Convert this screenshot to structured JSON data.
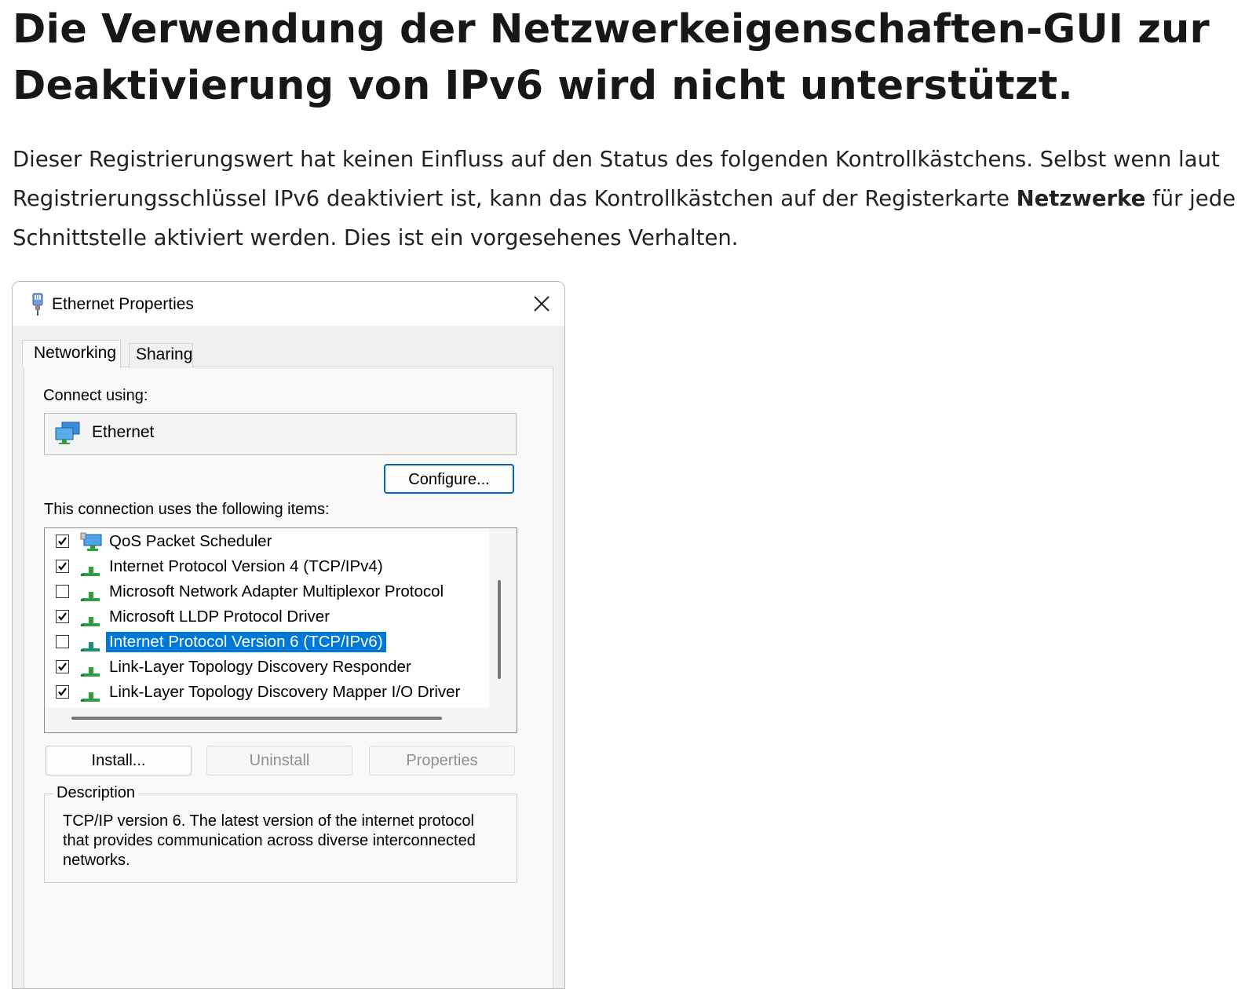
{
  "article": {
    "heading": "Die Verwendung der Netzwerkeigenschaften-GUI zur Deaktivierung von IPv6 wird nicht unterstützt.",
    "para_part1": "Dieser Registrierungswert hat keinen Einfluss auf den Status des folgenden Kontrollkästchens. Selbst wenn laut Registrierungsschlüssel IPv6 deaktiviert ist, kann das Kontrollkästchen auf der Registerkarte ",
    "para_bold": "Netzwerke",
    "para_part2": " für jede Schnittstelle aktiviert werden. Dies ist ein vorgesehenes Verhalten."
  },
  "dialog": {
    "title": "Ethernet Properties",
    "tabs": [
      "Networking",
      "Sharing"
    ],
    "connect_using_label": "Connect using:",
    "adapter": "Ethernet",
    "configure_label": "Configure...",
    "items_label": "This connection uses the following items:",
    "items": [
      {
        "label": "QoS Packet Scheduler",
        "checked": true,
        "icon": "qos-scheduler-icon",
        "selected": false
      },
      {
        "label": "Internet Protocol Version 4 (TCP/IPv4)",
        "checked": true,
        "icon": "network-protocol-icon",
        "selected": false
      },
      {
        "label": "Microsoft Network Adapter Multiplexor Protocol",
        "checked": false,
        "icon": "network-protocol-icon",
        "selected": false
      },
      {
        "label": "Microsoft LLDP Protocol Driver",
        "checked": true,
        "icon": "network-protocol-icon",
        "selected": false
      },
      {
        "label": "Internet Protocol Version 6 (TCP/IPv6)",
        "checked": false,
        "icon": "network-protocol-icon",
        "selected": true
      },
      {
        "label": "Link-Layer Topology Discovery Responder",
        "checked": true,
        "icon": "network-protocol-icon",
        "selected": false
      },
      {
        "label": "Link-Layer Topology Discovery Mapper I/O Driver",
        "checked": true,
        "icon": "network-protocol-icon",
        "selected": false
      }
    ],
    "install_label": "Install...",
    "uninstall_label": "Uninstall",
    "properties_label": "Properties",
    "description_legend": "Description",
    "description_text": "TCP/IP version 6. The latest version of the internet protocol that provides communication across diverse interconnected networks."
  },
  "colors": {
    "selection": "#0078d7",
    "primary_border": "#0067c0",
    "protocol_green": "#2e9e3e"
  }
}
